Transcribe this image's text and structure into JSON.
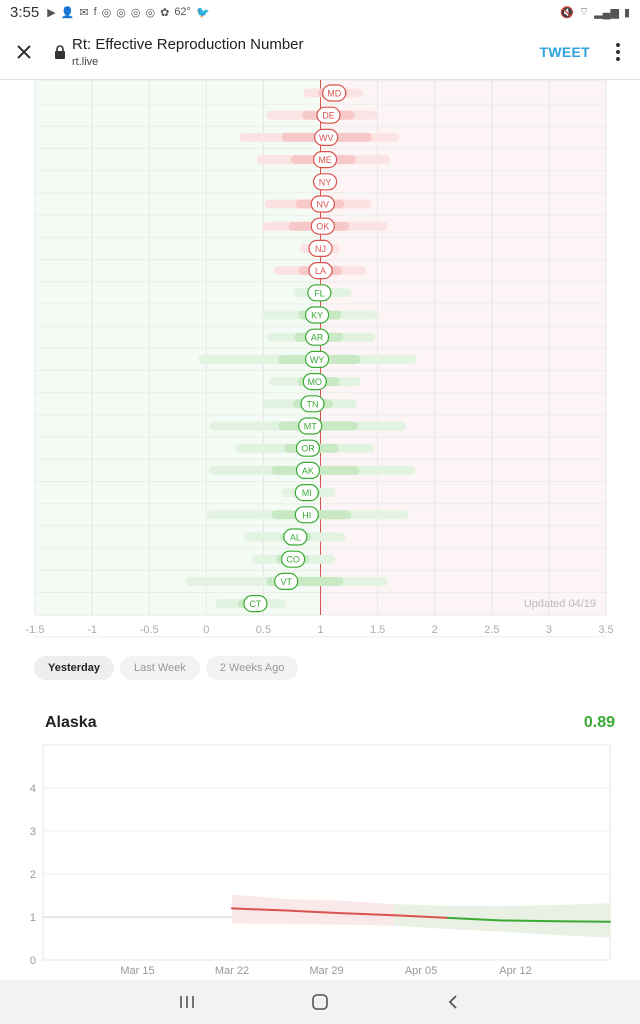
{
  "status_bar": {
    "time": "3:55",
    "temperature": "62°"
  },
  "app_bar": {
    "title": "Rt: Effective Reproduction Number",
    "url": "rt.live",
    "tweet_label": "TWEET"
  },
  "chart_data": [
    {
      "type": "range-dot",
      "xlim": [
        -1.5,
        3.5
      ],
      "x_ticks": [
        "-1.5",
        "-1",
        "-0.5",
        "0",
        "0.5",
        "1",
        "1.5",
        "2",
        "2.5",
        "3",
        "3.5"
      ],
      "reference_line": 1,
      "updated_label": "Updated 04/19",
      "states": [
        {
          "code": "MD",
          "rt": 1.12,
          "hdi80": [
            0.98,
            1.24
          ],
          "hdi95": [
            0.85,
            1.37
          ]
        },
        {
          "code": "DE",
          "rt": 1.07,
          "hdi80": [
            0.84,
            1.3
          ],
          "hdi95": [
            0.53,
            1.5
          ]
        },
        {
          "code": "WV",
          "rt": 1.05,
          "hdi80": [
            0.66,
            1.45
          ],
          "hdi95": [
            0.29,
            1.69
          ]
        },
        {
          "code": "ME",
          "rt": 1.04,
          "hdi80": [
            0.74,
            1.31
          ],
          "hdi95": [
            0.44,
            1.61
          ]
        },
        {
          "code": "NY",
          "rt": 1.04,
          "hdi80": [
            0.98,
            1.09
          ],
          "hdi95": [
            0.93,
            1.14
          ]
        },
        {
          "code": "NV",
          "rt": 1.02,
          "hdi80": [
            0.78,
            1.21
          ],
          "hdi95": [
            0.51,
            1.45
          ]
        },
        {
          "code": "OK",
          "rt": 1.02,
          "hdi80": [
            0.72,
            1.25
          ],
          "hdi95": [
            0.49,
            1.59
          ]
        },
        {
          "code": "NJ",
          "rt": 1.0,
          "hdi80": [
            0.92,
            1.08
          ],
          "hdi95": [
            0.82,
            1.17
          ]
        },
        {
          "code": "LA",
          "rt": 1.0,
          "hdi80": [
            0.81,
            1.19
          ],
          "hdi95": [
            0.59,
            1.4
          ]
        },
        {
          "code": "FL",
          "rt": 0.99,
          "hdi80": [
            0.89,
            1.1
          ],
          "hdi95": [
            0.76,
            1.27
          ]
        },
        {
          "code": "KY",
          "rt": 0.97,
          "hdi80": [
            0.81,
            1.18
          ],
          "hdi95": [
            0.48,
            1.5
          ]
        },
        {
          "code": "AR",
          "rt": 0.97,
          "hdi80": [
            0.77,
            1.2
          ],
          "hdi95": [
            0.53,
            1.48
          ]
        },
        {
          "code": "WY",
          "rt": 0.97,
          "hdi80": [
            0.63,
            1.35
          ],
          "hdi95": [
            -0.07,
            1.84
          ]
        },
        {
          "code": "MO",
          "rt": 0.95,
          "hdi80": [
            0.8,
            1.17
          ],
          "hdi95": [
            0.55,
            1.35
          ]
        },
        {
          "code": "TN",
          "rt": 0.93,
          "hdi80": [
            0.76,
            1.11
          ],
          "hdi95": [
            0.5,
            1.32
          ]
        },
        {
          "code": "MT",
          "rt": 0.91,
          "hdi80": [
            0.63,
            1.33
          ],
          "hdi95": [
            0.03,
            1.75
          ]
        },
        {
          "code": "OR",
          "rt": 0.89,
          "hdi80": [
            0.68,
            1.16
          ],
          "hdi95": [
            0.25,
            1.47
          ]
        },
        {
          "code": "AK",
          "rt": 0.89,
          "hdi80": [
            0.57,
            1.34
          ],
          "hdi95": [
            0.02,
            1.83
          ]
        },
        {
          "code": "MI",
          "rt": 0.88,
          "hdi80": [
            0.78,
            1.0
          ],
          "hdi95": [
            0.66,
            1.13
          ]
        },
        {
          "code": "HI",
          "rt": 0.88,
          "hdi80": [
            0.57,
            1.27
          ],
          "hdi95": [
            0.0,
            1.77
          ]
        },
        {
          "code": "AL",
          "rt": 0.78,
          "hdi80": [
            0.65,
            0.92
          ],
          "hdi95": [
            0.33,
            1.22
          ]
        },
        {
          "code": "CO",
          "rt": 0.76,
          "hdi80": [
            0.61,
            0.9
          ],
          "hdi95": [
            0.4,
            1.13
          ]
        },
        {
          "code": "VT",
          "rt": 0.7,
          "hdi80": [
            0.53,
            1.2
          ],
          "hdi95": [
            -0.18,
            1.59
          ]
        },
        {
          "code": "CT",
          "rt": 0.43,
          "hdi80": [
            0.28,
            0.53
          ],
          "hdi95": [
            0.08,
            0.7
          ]
        }
      ]
    },
    {
      "type": "line",
      "title": "Alaska",
      "current_value": "0.89",
      "ylim": [
        0,
        5
      ],
      "y_ticks": [
        "0",
        "1",
        "2",
        "3",
        "4"
      ],
      "x_ticks": [
        "Mar 15",
        "Mar 22",
        "Mar 29",
        "Apr 05",
        "Apr 12"
      ],
      "x": [
        "2020-03-22",
        "2020-03-26",
        "2020-03-30",
        "2020-04-03",
        "2020-04-07",
        "2020-04-11",
        "2020-04-15",
        "2020-04-19"
      ],
      "rt": [
        1.2,
        1.15,
        1.09,
        1.04,
        0.98,
        0.92,
        0.9,
        0.89
      ],
      "upper": [
        1.52,
        1.42,
        1.38,
        1.3,
        1.26,
        1.25,
        1.28,
        1.32
      ],
      "lower": [
        0.85,
        0.84,
        0.82,
        0.8,
        0.72,
        0.66,
        0.58,
        0.52
      ]
    }
  ],
  "timeframe_tabs": [
    "Yesterday",
    "Last Week",
    "2 Weeks Ago"
  ],
  "colors": {
    "above_one": "#d9534f",
    "below_one": "#3aaa35",
    "accent": "#2ea3dd"
  }
}
